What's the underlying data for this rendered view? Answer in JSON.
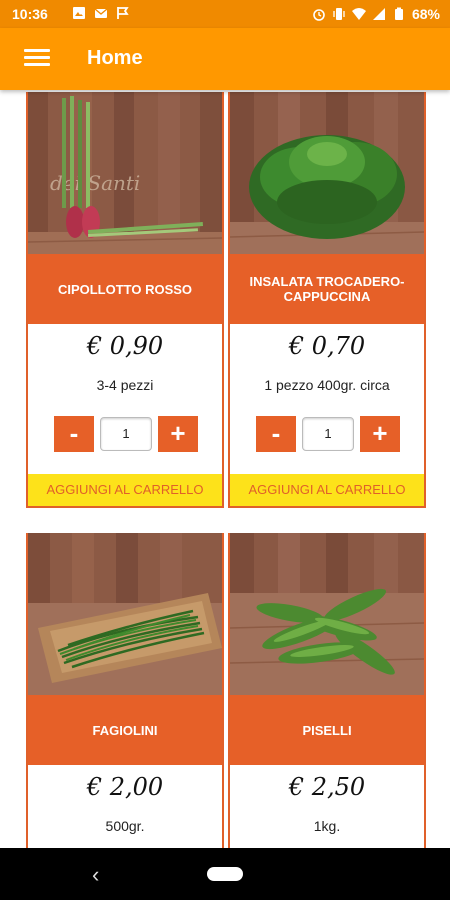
{
  "status_bar": {
    "time": "10:36",
    "battery": "68%",
    "left_icons": [
      "image-icon",
      "mail-icon",
      "flag-icon"
    ],
    "right_icons": [
      "alarm-icon",
      "vibrate-icon",
      "wifi-icon",
      "signal-icon",
      "battery-icon"
    ]
  },
  "app_bar": {
    "title": "Home",
    "menu_icon": "hamburger-menu-icon",
    "color": "#ff9800"
  },
  "products": [
    {
      "name": "CIPOLLOTTO ROSSO",
      "price": "€ 0,90",
      "description": "3-4 pezzi",
      "quantity": "1",
      "minus_label": "-",
      "plus_label": "+",
      "add_label": "AGGIUNGI AL CARRELLO",
      "photo_watermark": "dei Santi"
    },
    {
      "name": "INSALATA TROCADERO-CAPPUCCINA",
      "price": "€ 0,70",
      "description": "1 pezzo 400gr. circa",
      "quantity": "1",
      "minus_label": "-",
      "plus_label": "+",
      "add_label": "AGGIUNGI AL CARRELLO"
    },
    {
      "name": "FAGIOLINI",
      "price": "€ 2,00",
      "description": "500gr."
    },
    {
      "name": "PISELLI",
      "price": "€ 2,50",
      "description": "1kg."
    }
  ],
  "colors": {
    "accent": "#e66028",
    "cart_button": "#fde21a",
    "status_bar": "#f08a00"
  },
  "nav_bar": {
    "back_icon": "back-chevron-icon",
    "home_icon": "home-pill-icon"
  }
}
